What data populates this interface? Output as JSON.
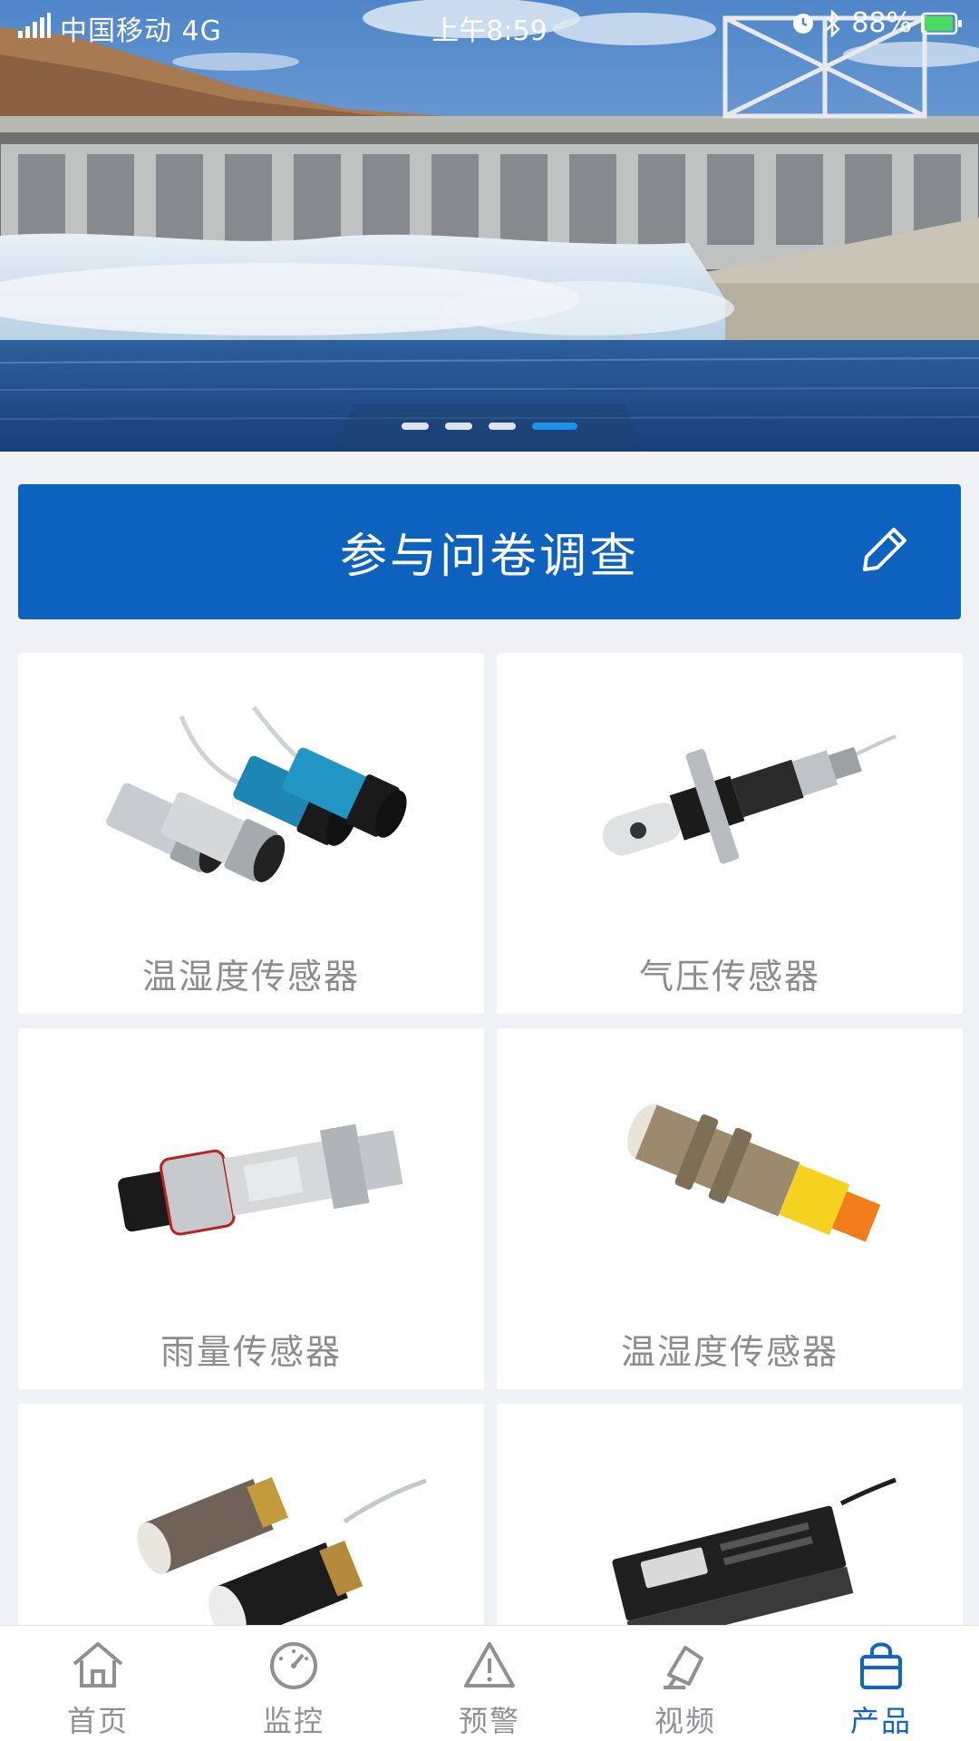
{
  "status_bar": {
    "carrier": "中国移动 4G",
    "time": "上午8:59",
    "battery_percent": "88%",
    "signal_icon": "signal-bars-icon",
    "alarm_icon": "alarm-icon",
    "bluetooth_icon": "bluetooth-icon",
    "battery_icon": "battery-icon"
  },
  "banner": {
    "slide_count": 4,
    "active_slide_index": 3
  },
  "survey": {
    "label": "参与问卷调查",
    "icon": "pencil-icon",
    "color": "#0d62c0"
  },
  "products": [
    {
      "name": "温湿度传感器"
    },
    {
      "name": "气压传感器"
    },
    {
      "name": "雨量传感器"
    },
    {
      "name": "温湿度传感器"
    },
    {
      "name": ""
    },
    {
      "name": ""
    }
  ],
  "tabbar": {
    "items": [
      {
        "label": "首页",
        "icon": "home-icon"
      },
      {
        "label": "监控",
        "icon": "gauge-icon"
      },
      {
        "label": "预警",
        "icon": "warning-icon"
      },
      {
        "label": "视频",
        "icon": "camera-icon"
      },
      {
        "label": "产品",
        "icon": "shopping-bag-icon"
      }
    ],
    "active_index": 4,
    "active_color": "#1064c6",
    "inactive_color": "#8f8f96"
  }
}
